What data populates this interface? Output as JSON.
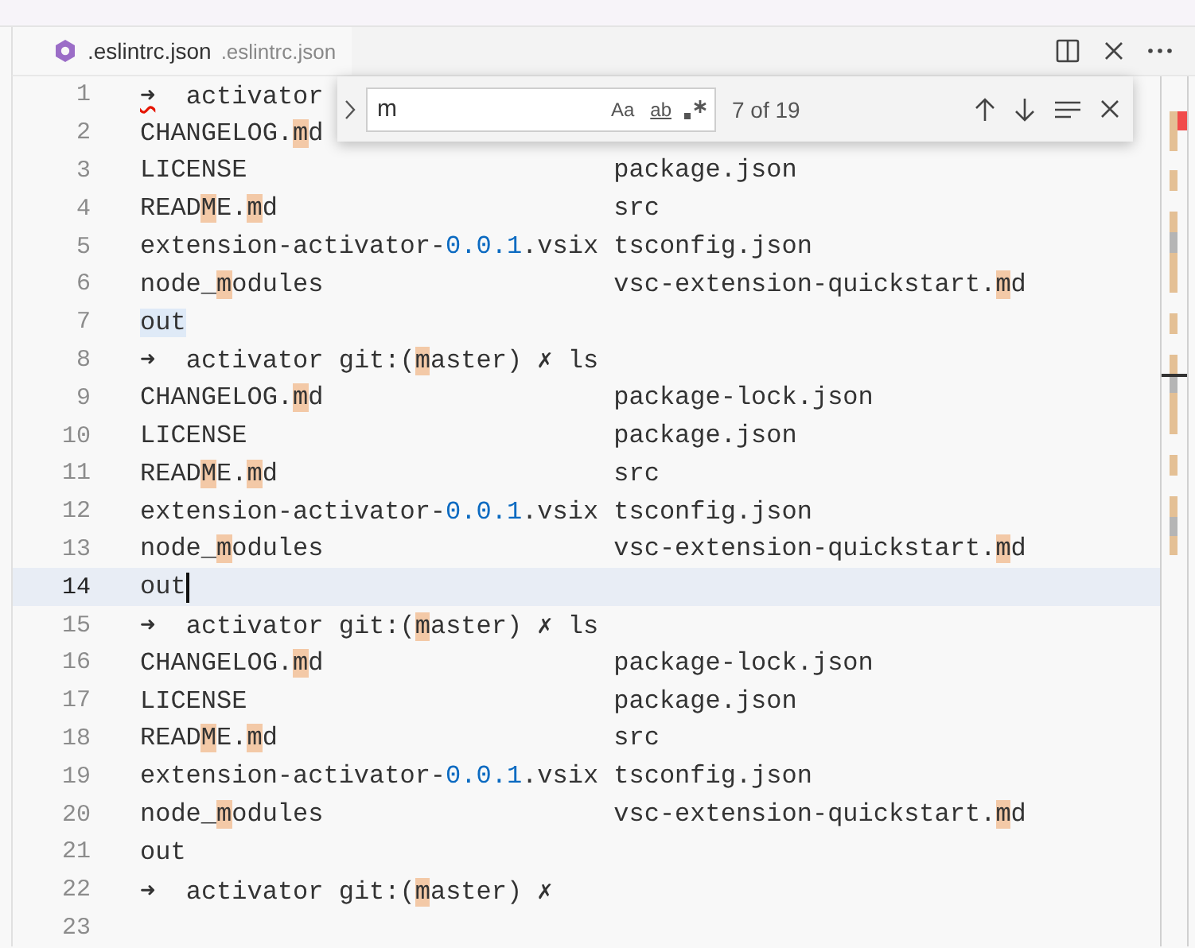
{
  "tab": {
    "label": ".eslintrc.json",
    "description": ".eslintrc.json"
  },
  "find": {
    "value": "m",
    "options": [
      {
        "kind": "case",
        "label": "Aa",
        "on": false
      },
      {
        "kind": "word",
        "label": "ab",
        "on": false
      },
      {
        "kind": "regex",
        "on": false
      }
    ],
    "count": "7 of 19"
  },
  "lines": [
    {
      "number": "1",
      "current": false,
      "cursor": false,
      "left": [
        {
          "text": "➜",
          "kind": "error"
        },
        {
          "text": "  activator",
          "kind": "plain"
        }
      ]
    },
    {
      "number": "2",
      "current": false,
      "cursor": false,
      "left": [
        {
          "text": "CHANGELOG.",
          "kind": "plain"
        },
        {
          "text": "m",
          "kind": "match"
        },
        {
          "text": "d",
          "kind": "plain"
        }
      ]
    },
    {
      "number": "3",
      "current": false,
      "cursor": false,
      "left": [
        {
          "text": "LICENSE",
          "kind": "plain"
        }
      ],
      "right": [
        {
          "text": "package.json",
          "kind": "plain"
        }
      ]
    },
    {
      "number": "4",
      "current": false,
      "cursor": false,
      "left": [
        {
          "text": "READ",
          "kind": "plain"
        },
        {
          "text": "M",
          "kind": "match"
        },
        {
          "text": "E.",
          "kind": "plain"
        },
        {
          "text": "m",
          "kind": "match"
        },
        {
          "text": "d",
          "kind": "plain"
        }
      ],
      "right": [
        {
          "text": "src",
          "kind": "plain"
        }
      ]
    },
    {
      "number": "5",
      "current": false,
      "cursor": false,
      "left": [
        {
          "text": "extension-activator-",
          "kind": "plain"
        },
        {
          "text": "0.0.1",
          "kind": "number"
        },
        {
          "text": ".vsix",
          "kind": "plain"
        }
      ],
      "right": [
        {
          "text": "tsconfig.json",
          "kind": "plain"
        }
      ]
    },
    {
      "number": "6",
      "current": false,
      "cursor": false,
      "left": [
        {
          "text": "node_",
          "kind": "plain"
        },
        {
          "text": "m",
          "kind": "match"
        },
        {
          "text": "odules",
          "kind": "plain"
        }
      ],
      "right": [
        {
          "text": "vsc-extension-quickstart.",
          "kind": "plain"
        },
        {
          "text": "m",
          "kind": "match"
        },
        {
          "text": "d",
          "kind": "plain"
        }
      ]
    },
    {
      "number": "7",
      "current": false,
      "cursor": false,
      "left": [
        {
          "text": "out",
          "kind": "word"
        }
      ]
    },
    {
      "number": "8",
      "current": false,
      "cursor": false,
      "left": [
        {
          "text": "➜  activator git:(",
          "kind": "plain"
        },
        {
          "text": "m",
          "kind": "match"
        },
        {
          "text": "aster) ✗ ls",
          "kind": "plain"
        }
      ]
    },
    {
      "number": "9",
      "current": false,
      "cursor": false,
      "left": [
        {
          "text": "CHANGELOG.",
          "kind": "plain"
        },
        {
          "text": "m",
          "kind": "match"
        },
        {
          "text": "d",
          "kind": "plain"
        }
      ],
      "right": [
        {
          "text": "package-lock.json",
          "kind": "plain"
        }
      ]
    },
    {
      "number": "10",
      "current": false,
      "cursor": false,
      "left": [
        {
          "text": "LICENSE",
          "kind": "plain"
        }
      ],
      "right": [
        {
          "text": "package.json",
          "kind": "plain"
        }
      ]
    },
    {
      "number": "11",
      "current": false,
      "cursor": false,
      "left": [
        {
          "text": "READ",
          "kind": "plain"
        },
        {
          "text": "M",
          "kind": "match"
        },
        {
          "text": "E.",
          "kind": "plain"
        },
        {
          "text": "m",
          "kind": "match"
        },
        {
          "text": "d",
          "kind": "plain"
        }
      ],
      "right": [
        {
          "text": "src",
          "kind": "plain"
        }
      ]
    },
    {
      "number": "12",
      "current": false,
      "cursor": false,
      "left": [
        {
          "text": "extension-activator-",
          "kind": "plain"
        },
        {
          "text": "0.0.1",
          "kind": "number"
        },
        {
          "text": ".vsix",
          "kind": "plain"
        }
      ],
      "right": [
        {
          "text": "tsconfig.json",
          "kind": "plain"
        }
      ]
    },
    {
      "number": "13",
      "current": false,
      "cursor": false,
      "left": [
        {
          "text": "node_",
          "kind": "plain"
        },
        {
          "text": "m",
          "kind": "match"
        },
        {
          "text": "odules",
          "kind": "plain"
        }
      ],
      "right": [
        {
          "text": "vsc-extension-quickstart.",
          "kind": "plain"
        },
        {
          "text": "m",
          "kind": "match"
        },
        {
          "text": "d",
          "kind": "plain"
        }
      ]
    },
    {
      "number": "14",
      "current": true,
      "cursor": true,
      "left": [
        {
          "text": "out",
          "kind": "plain"
        }
      ]
    },
    {
      "number": "15",
      "current": false,
      "cursor": false,
      "left": [
        {
          "text": "➜  activator git:(",
          "kind": "plain"
        },
        {
          "text": "m",
          "kind": "match"
        },
        {
          "text": "aster) ✗ ls",
          "kind": "plain"
        }
      ]
    },
    {
      "number": "16",
      "current": false,
      "cursor": false,
      "left": [
        {
          "text": "CHANGELOG.",
          "kind": "plain"
        },
        {
          "text": "m",
          "kind": "match"
        },
        {
          "text": "d",
          "kind": "plain"
        }
      ],
      "right": [
        {
          "text": "package-lock.json",
          "kind": "plain"
        }
      ]
    },
    {
      "number": "17",
      "current": false,
      "cursor": false,
      "left": [
        {
          "text": "LICENSE",
          "kind": "plain"
        }
      ],
      "right": [
        {
          "text": "package.json",
          "kind": "plain"
        }
      ]
    },
    {
      "number": "18",
      "current": false,
      "cursor": false,
      "left": [
        {
          "text": "READ",
          "kind": "plain"
        },
        {
          "text": "M",
          "kind": "match"
        },
        {
          "text": "E.",
          "kind": "plain"
        },
        {
          "text": "m",
          "kind": "match"
        },
        {
          "text": "d",
          "kind": "plain"
        }
      ],
      "right": [
        {
          "text": "src",
          "kind": "plain"
        }
      ]
    },
    {
      "number": "19",
      "current": false,
      "cursor": false,
      "left": [
        {
          "text": "extension-activator-",
          "kind": "plain"
        },
        {
          "text": "0.0.1",
          "kind": "number"
        },
        {
          "text": ".vsix",
          "kind": "plain"
        }
      ],
      "right": [
        {
          "text": "tsconfig.json",
          "kind": "plain"
        }
      ]
    },
    {
      "number": "20",
      "current": false,
      "cursor": false,
      "left": [
        {
          "text": "node_",
          "kind": "plain"
        },
        {
          "text": "m",
          "kind": "match"
        },
        {
          "text": "odules",
          "kind": "plain"
        }
      ],
      "right": [
        {
          "text": "vsc-extension-quickstart.",
          "kind": "plain"
        },
        {
          "text": "m",
          "kind": "match"
        },
        {
          "text": "d",
          "kind": "plain"
        }
      ]
    },
    {
      "number": "21",
      "current": false,
      "cursor": false,
      "left": [
        {
          "text": "out",
          "kind": "plain"
        }
      ]
    },
    {
      "number": "22",
      "current": false,
      "cursor": false,
      "left": [
        {
          "text": "➜  activator git:(",
          "kind": "plain"
        },
        {
          "text": "m",
          "kind": "match"
        },
        {
          "text": "aster) ✗",
          "kind": "plain"
        }
      ]
    },
    {
      "number": "23",
      "current": false,
      "cursor": false
    }
  ]
}
